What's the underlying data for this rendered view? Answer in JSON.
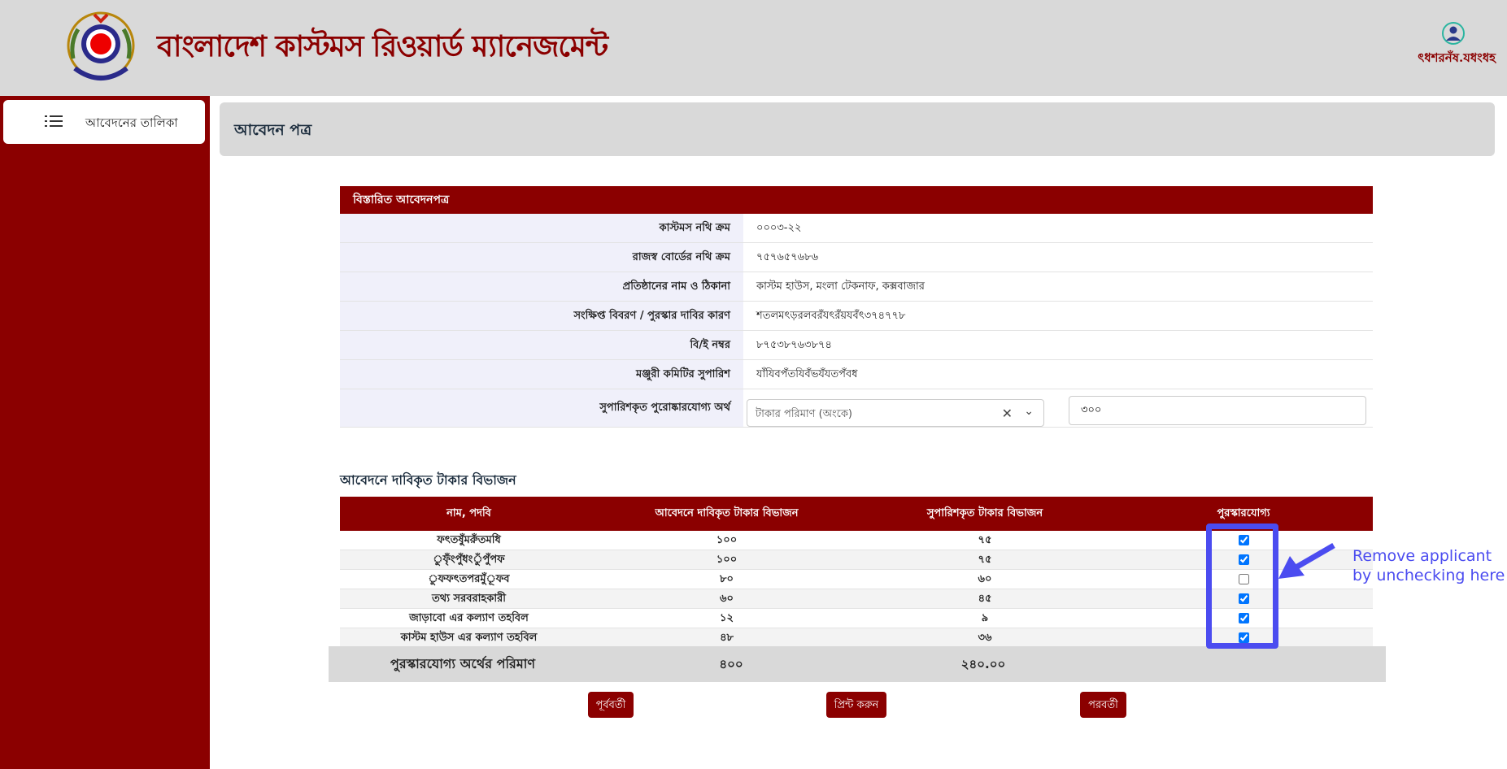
{
  "header": {
    "app_title": "বাংলাদেশ কাস্টমস রিওয়ার্ড ম্যানেজমেন্ট",
    "logo_icon": "bangladesh-customs-logo",
    "user_icon": "user-avatar-icon",
    "user_name": "ৎধশরনঁষ.যধংধহ"
  },
  "sidebar": {
    "items": [
      {
        "label": "আবেদনের তালিকা",
        "icon": "list-icon"
      }
    ]
  },
  "page": {
    "title": "আবেদন পত্র"
  },
  "details": {
    "header": "বিস্তারিত আবেদনপত্র",
    "rows": [
      {
        "label": "কাস্টমস নথি ক্রম",
        "value": "০০০৩-২২"
      },
      {
        "label": "রাজস্ব বোর্ডের নথি ক্রম",
        "value": "৭৫৭৬৫৭৬৮৬"
      },
      {
        "label": "প্রতিষ্ঠানের নাম ও ঠিকানা",
        "value": "কাস্টম হাউস, মংলা টেকনাফ, কক্সবাজার"
      },
      {
        "label": "সংক্ষিপ্ত বিবরণ / পুরস্কার দাবির কারণ",
        "value": "শতলমৎড়রলবরঁযৎরঁয়যবঁৎ৩৭৪৭৭৮"
      },
      {
        "label": "বি/ই নম্বর",
        "value": "৮৭৫৩৮৭৬৩৮৭৪"
      },
      {
        "label": "মঞ্জুরী কমিটির সুপারিশ",
        "value": "যাঁযিবপঁতযিবঁভযঁযতপঁবধ"
      }
    ],
    "recommended_label": "সুপারিশকৃত পুরোষ্কারযোগ্য অর্থ",
    "select_placeholder": "টাকার পরিমাণ (অংকে)",
    "amount_value": "৩০০"
  },
  "split": {
    "title": "আবেদনে দাবিকৃত টাকার বিভাজন",
    "columns": [
      "নাম, পদবি",
      "আবেদনে দাবিকৃত টাকার বিভাজন",
      "সুপারিশকৃত টাকার বিভাজন",
      "পুরস্কারযোগ্য"
    ],
    "rows": [
      {
        "name": "ফৎতষুঁমরুঁতমধি",
        "claimed": "১০০",
        "recommended": "৭৫",
        "eligible": true
      },
      {
        "name": "ুফৃঁংপুঁধংুঁপুঁপফ",
        "claimed": "১০০",
        "recommended": "৭৫",
        "eligible": true
      },
      {
        "name": "ুফফৎতপরমুঁূফব",
        "claimed": "৮০",
        "recommended": "৬০",
        "eligible": false
      },
      {
        "name": "তথ্য সরবরাহকারী",
        "claimed": "৬০",
        "recommended": "৪৫",
        "eligible": true
      },
      {
        "name": "জাড়াবো এর কল্যাণ তহবিল",
        "claimed": "১২",
        "recommended": "৯",
        "eligible": true
      },
      {
        "name": "কাস্টম হাউস এর কল্যাণ তহবিল",
        "claimed": "৪৮",
        "recommended": "৩৬",
        "eligible": true
      }
    ],
    "total_label": "পুরস্কারযোগ্য অর্থের পরিমাণ",
    "total_claimed": "৪০০",
    "total_recommended": "২৪০.০০"
  },
  "buttons": {
    "prev": "পূর্ববর্তী",
    "print": "প্রিন্ট করুন",
    "next": "পরবর্তী"
  },
  "annotation": {
    "line1": "Remove applicant",
    "line2": "by unchecking here",
    "color": "#4b4cf0"
  },
  "colors": {
    "brand": "#8b0000",
    "header_bg": "#d9d9d9"
  }
}
